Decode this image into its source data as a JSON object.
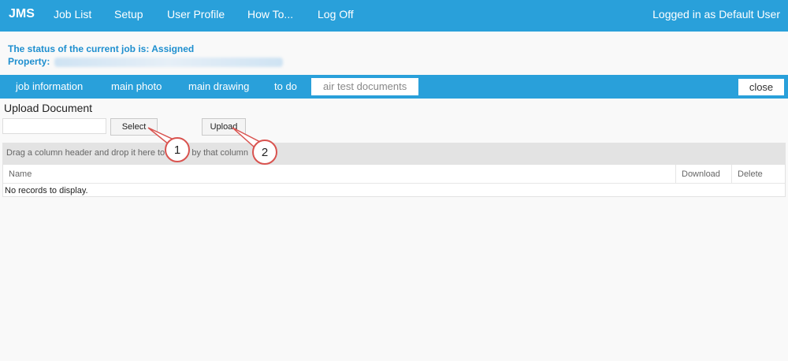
{
  "header": {
    "brand": "JMS",
    "nav": [
      "Job List",
      "Setup",
      "User Profile",
      "How To...",
      "Log Off"
    ],
    "user_status": "Logged in as Default User"
  },
  "status": {
    "job_status": "The status of the current job is: Assigned",
    "property_label": "Property:"
  },
  "tabs": {
    "items": [
      "job information",
      "main photo",
      "main drawing",
      "to do",
      "air test documents"
    ],
    "close_label": "close"
  },
  "upload": {
    "title": "Upload Document",
    "select_label": "Select",
    "upload_label": "Upload"
  },
  "grid": {
    "group_hint": "Drag a column header and drop it here to group by that column",
    "columns": [
      "Name",
      "Download",
      "Delete"
    ],
    "empty_text": "No records to display."
  },
  "callouts": [
    "1",
    "2"
  ],
  "colors": {
    "brand_blue": "#29a0da",
    "status_text": "#1e8fcf",
    "callout_red": "#d9534f"
  }
}
